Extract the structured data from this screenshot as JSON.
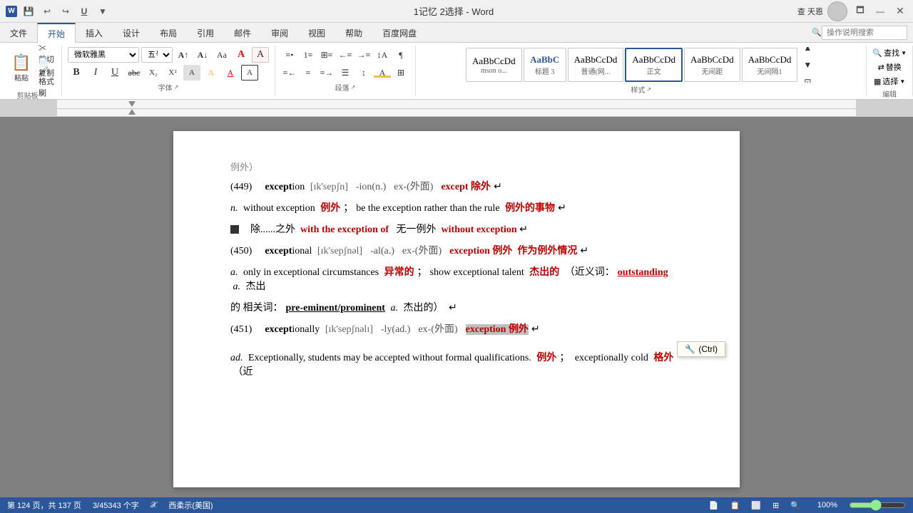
{
  "titlebar": {
    "save_icon": "💾",
    "undo_icon": "↩",
    "redo_icon": "↪",
    "underline_icon": "U̲",
    "title": "1记忆 2选择 - Word",
    "query_label": "查 天恩",
    "maximize_icon": "🗖",
    "minimize_icon": "—",
    "close_icon": "✕"
  },
  "tabs": [
    {
      "label": "文件",
      "active": false
    },
    {
      "label": "开始",
      "active": true
    },
    {
      "label": "插入",
      "active": false
    },
    {
      "label": "设计",
      "active": false
    },
    {
      "label": "布局",
      "active": false
    },
    {
      "label": "引用",
      "active": false
    },
    {
      "label": "邮件",
      "active": false
    },
    {
      "label": "审阅",
      "active": false
    },
    {
      "label": "视图",
      "active": false
    },
    {
      "label": "帮助",
      "active": false
    },
    {
      "label": "百度网盘",
      "active": false
    }
  ],
  "search_placeholder": "操作说明搜索",
  "ribbon": {
    "clipboard": {
      "label": "剪贴板",
      "paste": "粘贴",
      "cut": "剪切",
      "copy": "复制",
      "format_painter": "格式刷"
    },
    "font": {
      "label": "字体",
      "font_name": "微软雅黑",
      "font_size": "五号",
      "bold": "B",
      "italic": "I",
      "underline": "U",
      "strikethrough": "abc",
      "subscript": "X₂",
      "superscript": "X²"
    },
    "paragraph": {
      "label": "段落"
    },
    "styles": {
      "label": "样式",
      "items": [
        {
          "name": "msono...",
          "preview": "AaBbCcDd"
        },
        {
          "name": "标题 3",
          "preview": "AaBbC",
          "active": false
        },
        {
          "name": "普通(网...",
          "preview": "AaBbCcDd"
        },
        {
          "name": "正文",
          "preview": "AaBbCcDd",
          "active": true
        },
        {
          "name": "无间距",
          "preview": "AaBbCcDd"
        },
        {
          "name": "无间隔1",
          "preview": "AaBbCcDd"
        }
      ]
    },
    "editing": {
      "label": "编辑",
      "find": "查找",
      "replace": "替换",
      "select": "选择"
    }
  },
  "document": {
    "entries": [
      {
        "id": "449",
        "word": "exception",
        "phonetic": "[ɪk'sepʃn]",
        "suffix": "-ion(n.)",
        "prefix": "ex-(外面)",
        "related": "except 除外"
      },
      {
        "id": "449_def",
        "italic_prefix": "n.",
        "text1": "without exception",
        "translation1": "例外",
        "text2": "be the exception rather than the rule",
        "translation2": "例外的事物"
      },
      {
        "id": "449_phrase",
        "text1": "除......之外",
        "phrase1": "with the exception of",
        "text2": "无一例外",
        "phrase2": "without exception"
      },
      {
        "id": "450",
        "word": "exceptional",
        "phonetic": "[ɪk'sepʃnəl]",
        "suffix": "-al(a.)",
        "prefix": "ex-(外面)",
        "related": "exception 例外",
        "translation": "作为例外情况"
      },
      {
        "id": "450_def",
        "italic_prefix": "a.",
        "text1": "only in exceptional circumstances",
        "translation1": "异常的",
        "text2": "show exceptional talent",
        "translation2": "杰出的",
        "synonym_label": "近义词：",
        "synonym": "outstanding",
        "synonym_suffix": "a. 杰出的"
      },
      {
        "id": "450_related",
        "related_label": "相关词：",
        "related_word": "pre-eminent/prominent",
        "related_pos": "a.",
        "related_translation": "杰出的"
      },
      {
        "id": "451",
        "word": "exceptionally",
        "phonetic": "[ɪk'sepʃnəlɪ]",
        "suffix": "-ly(ad.)",
        "prefix": "ex-(外面)",
        "related_highlight": "exception 例外"
      },
      {
        "id": "451_def",
        "italic_prefix": "ad.",
        "text1": "Exceptionally, students may be accepted without formal qualifications.",
        "translation1": "例外",
        "text2": "exceptionally cold",
        "translation2": "格外",
        "suffix_text": "（近"
      }
    ]
  },
  "status": {
    "page_info": "第 124 页，共 137 页",
    "word_count": "3/45343 个字",
    "lang_check": "𝒳",
    "language": "西柔示(美国)",
    "mode_icons": [
      "📄",
      "📋",
      "⬜",
      "⊞",
      "🔍"
    ],
    "zoom": "100%"
  },
  "tooltip": {
    "icon": "🔧",
    "label": "(Ctrl)"
  }
}
